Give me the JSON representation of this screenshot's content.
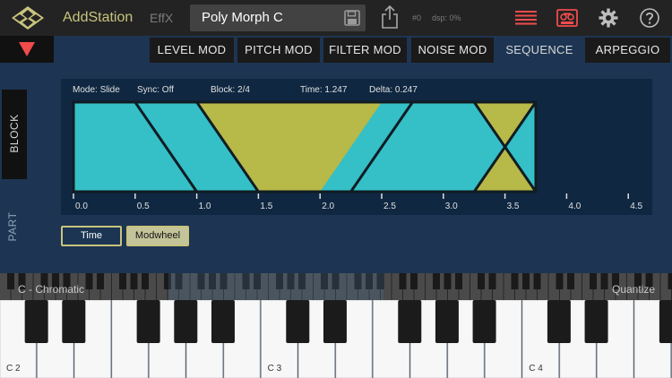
{
  "app": {
    "brand": "AddStation",
    "effx_label": "EffX",
    "preset_name": "Poly Morph C",
    "meta_number": "#0",
    "meta_dsp": "dsp: 0%"
  },
  "icons": {
    "logo": "diamond-logo-icon",
    "save": "save-icon",
    "share": "share-icon",
    "menu": "list-menu-icon",
    "tape": "tape-recorder-icon",
    "settings": "gear-icon",
    "help": "help-icon",
    "dropdown": "triangle-down-icon"
  },
  "colors": {
    "accent_yellow": "#c9c47e",
    "cyan": "#35bfc6",
    "olive": "#b7b948",
    "red": "#f24b4b"
  },
  "tabs": [
    {
      "label": "LEVEL MOD",
      "active": false
    },
    {
      "label": "PITCH MOD",
      "active": false
    },
    {
      "label": "FILTER MOD",
      "active": false
    },
    {
      "label": "NOISE MOD",
      "active": false
    },
    {
      "label": "SEQUENCE",
      "active": true
    },
    {
      "label": "ARPEGGIO",
      "active": false
    }
  ],
  "side_tabs": {
    "block": "BLOCK",
    "part": "PART"
  },
  "sequence": {
    "mode": "Mode: Slide",
    "sync": "Sync: Off",
    "block": "Block: 2/4",
    "time": "Time: 1.247",
    "delta": "Delta: 0.247",
    "axis_ticks": [
      "0.0",
      "0.5",
      "1.0",
      "1.5",
      "2.0",
      "2.5",
      "3.0",
      "3.5",
      "4.0",
      "4.5"
    ],
    "axis_max": 4.5,
    "sequence_end": 3.75,
    "slide_time": 0.5,
    "blocks": [
      {
        "start": 0.0,
        "end": 1.25
      },
      {
        "start": 1.0,
        "end": 2.5
      },
      {
        "start": 2.25,
        "end": 3.5
      },
      {
        "start": 3.25,
        "end": 3.75
      }
    ]
  },
  "buttons": {
    "time": "Time",
    "modwheel": "Modwheel"
  },
  "keyboard": {
    "scale": "C - Chromatic",
    "quantize": "Quantize",
    "octave_labels": [
      "C 2",
      "C 3",
      "C 4"
    ]
  }
}
